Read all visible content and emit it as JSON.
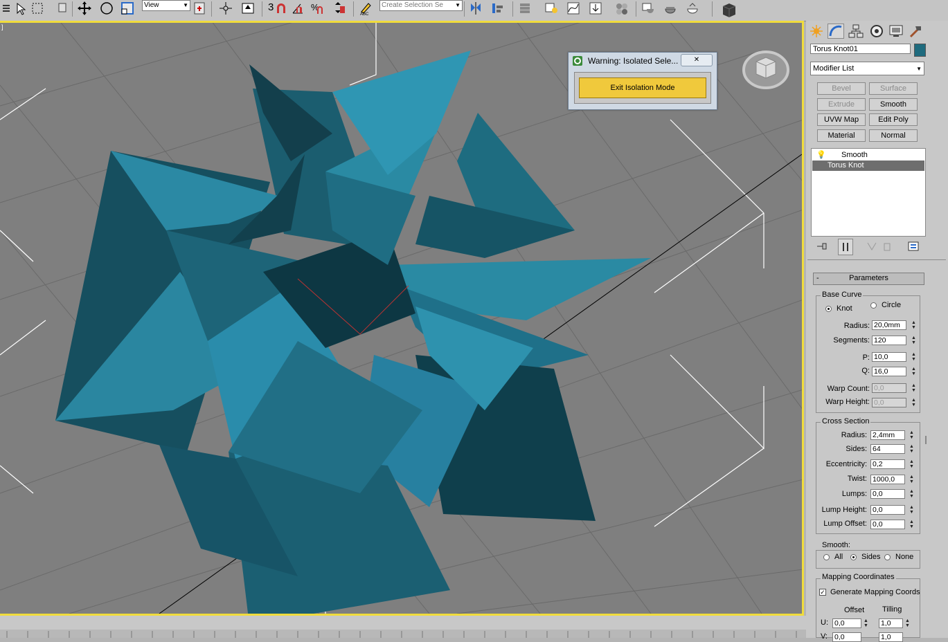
{
  "toolbar": {
    "reference_coord": "View",
    "named_selection_placeholder": "Create Selection Se",
    "snap_label": "3"
  },
  "dialog": {
    "title": "Warning: Isolated Sele...",
    "button": "Exit Isolation Mode",
    "close": "✕"
  },
  "panel": {
    "object_name": "Torus Knot01",
    "object_color": "#1f6b7e",
    "modifier_list": "Modifier List",
    "buttons": [
      {
        "label": "Bevel",
        "enabled": false
      },
      {
        "label": "Surface",
        "enabled": false
      },
      {
        "label": "Extrude",
        "enabled": false
      },
      {
        "label": "Smooth",
        "enabled": true
      },
      {
        "label": "UVW Map",
        "enabled": true
      },
      {
        "label": "Edit Poly",
        "enabled": true
      },
      {
        "label": "Material",
        "enabled": true
      },
      {
        "label": "Normal",
        "enabled": true
      }
    ],
    "stack": [
      "Smooth",
      "Torus Knot"
    ],
    "rollout_title": "Parameters",
    "rollout_toggle": "-",
    "base_curve": {
      "title": "Base Curve",
      "knot": "Knot",
      "circle": "Circle",
      "selected": "Knot",
      "radius_label": "Radius:",
      "radius": "20,0mm",
      "segments_label": "Segments:",
      "segments": "120",
      "p_label": "P:",
      "p": "10,0",
      "q_label": "Q:",
      "q": "16,0",
      "warp_count_label": "Warp Count:",
      "warp_count": "0,0",
      "warp_height_label": "Warp Height:",
      "warp_height": "0,0"
    },
    "cross_section": {
      "title": "Cross Section",
      "radius_label": "Radius:",
      "radius": "2,4mm",
      "sides_label": "Sides:",
      "sides": "64",
      "eccentricity_label": "Eccentricity:",
      "eccentricity": "0,2",
      "twist_label": "Twist:",
      "twist": "1000,0",
      "lumps_label": "Lumps:",
      "lumps": "0,0",
      "lump_height_label": "Lump Height:",
      "lump_height": "0,0",
      "lump_offset_label": "Lump Offset:",
      "lump_offset": "0,0"
    },
    "smooth": {
      "title": "Smooth:",
      "all": "All",
      "sides": "Sides",
      "none": "None",
      "selected": "Sides"
    },
    "mapping": {
      "title": "Mapping Coordinates",
      "generate": "Generate Mapping Coords",
      "generate_checked": true,
      "offset": "Offset",
      "tiling": "Tilling",
      "u_label": "U:",
      "u_offset": "0,0",
      "u_tiling": "1,0",
      "v_label": "V:",
      "v_offset": "0,0",
      "v_tiling": "1,0"
    }
  },
  "colors": {
    "viewport_bg": "#7f7f7f",
    "viewport_border": "#f0dc3c",
    "knot": "#1f6b7e",
    "exit_button": "#f0c93c"
  }
}
